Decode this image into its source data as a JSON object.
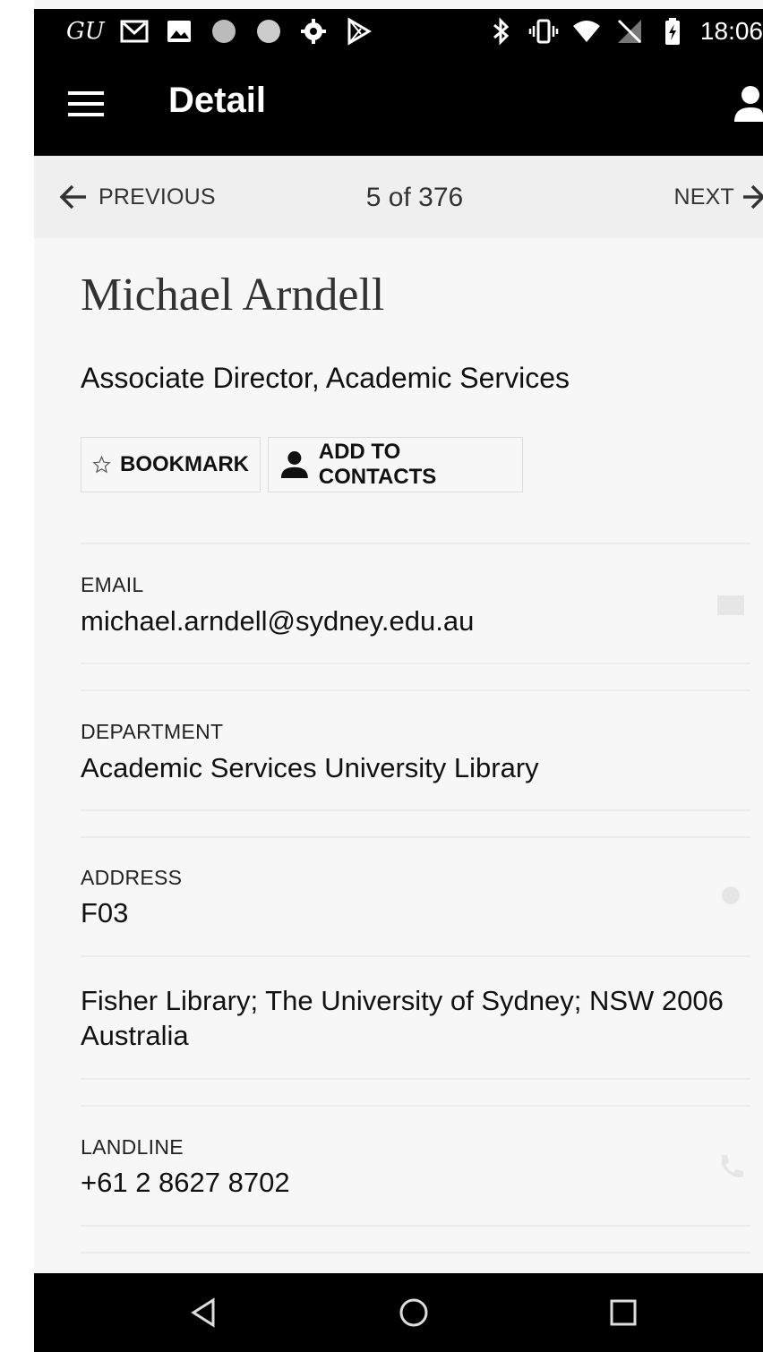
{
  "status_bar": {
    "left_text": "GU",
    "left_icons": [
      "gmail-icon",
      "image-icon",
      "circle-icon",
      "circle-icon",
      "settings-icon",
      "play-store-icon"
    ],
    "right_icons": [
      "bluetooth-icon",
      "vibrate-icon",
      "wifi-icon",
      "no-sim-icon",
      "battery-charging-icon"
    ],
    "time": "18:06"
  },
  "app_bar": {
    "title": "Detail",
    "menu_icon": "hamburger-menu-icon",
    "account_icon": "person-icon"
  },
  "pager": {
    "previous_label": "PREVIOUS",
    "position": "5 of 376",
    "next_label": "NEXT"
  },
  "person": {
    "name": "Michael Arndell",
    "role": "Associate Director, Academic Services"
  },
  "actions": {
    "bookmark_label": "BOOKMARK",
    "add_contact_label": "ADD TO CONTACTS"
  },
  "fields": {
    "email": {
      "label": "EMAIL",
      "value": "michael.arndell@sydney.edu.au"
    },
    "department": {
      "label": "DEPARTMENT",
      "value": "Academic Services University Library"
    },
    "address": {
      "label": "ADDRESS",
      "value": "F03",
      "detail": "Fisher Library; The University of Sydney; NSW 2006 Australia"
    },
    "landline": {
      "label": "LANDLINE",
      "value": "+61 2 8627 8702"
    }
  },
  "colors": {
    "bar_background": "#000000",
    "page_background": "#f7f7f7",
    "pager_background": "#efefef",
    "text_primary": "#111111",
    "divider": "#ececec"
  }
}
